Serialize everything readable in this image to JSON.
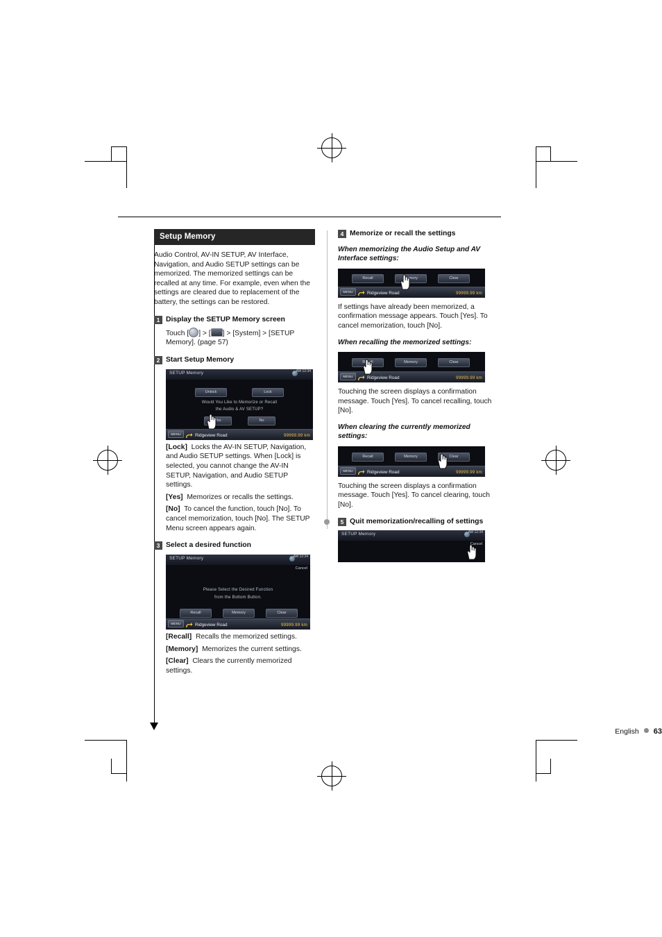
{
  "footer": {
    "language": "English",
    "page": "63"
  },
  "left": {
    "section_title": "Setup Memory",
    "intro": "Audio Control, AV-IN SETUP, AV Interface, Navigation, and Audio SETUP settings can be memorized. The memorized settings can be recalled at any time. For example, even when the settings are cleared due to replacement of the battery, the settings can be restored.",
    "step1": {
      "num": "1",
      "title": "Display the SETUP Memory screen",
      "text_pre": "Touch [",
      "text_mid": "] > [",
      "text_mid2": "] > [System] > [SETUP Memory]. (page 57)"
    },
    "step2": {
      "num": "2",
      "title": "Start Setup Memory",
      "screen": {
        "title": "SETUP Memory",
        "clock": "AM 12:34",
        "btn_unlock": "Unlock",
        "btn_lock": "Lock",
        "msg_line1": "Would You Like to Memorize or Recall",
        "msg_line2": "the Audio & AV SETUP?",
        "btn_yes": "Yes",
        "btn_no": "No",
        "menu": "MENU",
        "road": "Ridgeview Road",
        "odo": "99999.99 km"
      },
      "defs": [
        {
          "term": "[Lock]",
          "desc": "Locks the AV-IN SETUP, Navigation, and Audio SETUP settings. When [Lock] is selected, you cannot change the AV-IN SETUP, Navigation, and Audio SETUP settings."
        },
        {
          "term": "[Yes]",
          "desc": "Memorizes or recalls the settings."
        },
        {
          "term": "[No]",
          "desc": "To cancel the function, touch [No]. To cancel memorization, touch [No]. The SETUP Menu screen appears again."
        }
      ]
    },
    "step3": {
      "num": "3",
      "title": "Select a desired function",
      "screen": {
        "title": "SETUP Memory",
        "clock": "AM 12:34",
        "cancel": "Cancel",
        "msg_line1": "Please Select the Desired Function",
        "msg_line2": "from the Bottom Button.",
        "btn_recall": "Recall",
        "btn_memory": "Memory",
        "btn_clear": "Clear",
        "menu": "MENU",
        "road": "Ridgeview Road",
        "odo": "99999.99 km"
      },
      "defs": [
        {
          "term": "[Recall]",
          "desc": "Recalls the memorized settings."
        },
        {
          "term": "[Memory]",
          "desc": "Memorizes the current settings."
        },
        {
          "term": "[Clear]",
          "desc": "Clears the currently memorized settings."
        }
      ]
    }
  },
  "right": {
    "step4": {
      "num": "4",
      "title": "Memorize or recall the settings",
      "sub1": {
        "heading": "When memorizing the Audio Setup and AV Interface settings:",
        "screen": {
          "btn_recall": "Recall",
          "btn_memory": "Memory",
          "btn_clear": "Clear",
          "menu": "MENU",
          "road": "Ridgeview Road",
          "odo": "99999.99 km"
        },
        "text": "If settings have already been memorized, a confirmation message appears. Touch [Yes]. To cancel memorization, touch [No]."
      },
      "sub2": {
        "heading": "When recalling the memorized settings:",
        "screen": {
          "btn_recall": "Recall",
          "btn_memory": "Memory",
          "btn_clear": "Clear",
          "menu": "MENU",
          "road": "Ridgeview Road",
          "odo": "99999.99 km"
        },
        "text": "Touching the screen displays a confirmation message. Touch [Yes]. To cancel recalling, touch [No]."
      },
      "sub3": {
        "heading": "When clearing the currently memorized settings:",
        "screen": {
          "btn_recall": "Recall",
          "btn_memory": "Memory",
          "btn_clear": "Clear",
          "menu": "MENU",
          "road": "Ridgeview Road",
          "odo": "99999.99 km"
        },
        "text": "Touching the screen displays a confirmation message. Touch [Yes]. To cancel clearing, touch [No]."
      }
    },
    "step5": {
      "num": "5",
      "title": "Quit memorization/recalling of settings",
      "screen": {
        "title": "SETUP Memory",
        "clock": "AM 12:34",
        "cancel": "Cancel"
      }
    }
  }
}
